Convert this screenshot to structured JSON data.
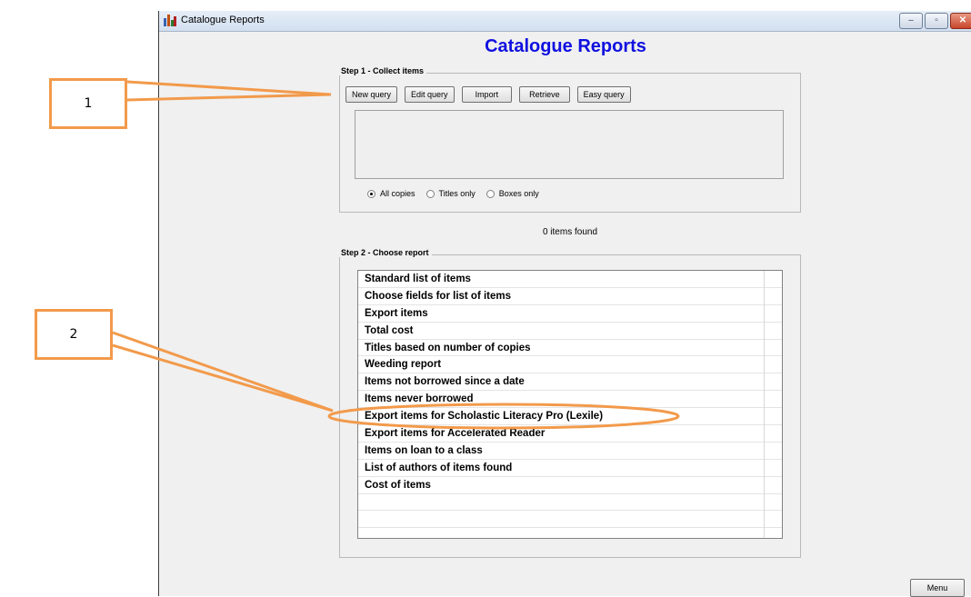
{
  "window": {
    "title": "Catalogue Reports",
    "icons": {
      "app": "bar-chart-icon",
      "minimize": "minimize-icon",
      "maximize": "maximize-icon",
      "close": "close-icon"
    },
    "minimize_glyph": "–",
    "maximize_glyph": "▫",
    "close_glyph": "✕"
  },
  "main_title": "Catalogue Reports",
  "step1": {
    "legend": "Step 1 - Collect items",
    "buttons": [
      "New query",
      "Edit query",
      "Import",
      "Retrieve",
      "Easy query"
    ],
    "radios": [
      {
        "label": "All copies",
        "selected": true
      },
      {
        "label": "Titles only",
        "selected": false
      },
      {
        "label": "Boxes only",
        "selected": false
      }
    ]
  },
  "items_found": "0 items found",
  "step2": {
    "legend": "Step 2 - Choose report",
    "reports": [
      "Standard list of items",
      "Choose fields for list of items",
      "Export items",
      "Total cost",
      "Titles based on number of copies",
      "Weeding report",
      "Items not borrowed since a date",
      "Items never borrowed",
      "Export items for Scholastic Literacy Pro (Lexile)",
      "Export items for Accelerated Reader",
      "Items on loan to a class",
      "List of authors of items found",
      "Cost of items",
      "",
      "",
      ""
    ]
  },
  "menu_button": "Menu",
  "annotations": {
    "callout1": "1",
    "callout2": "2",
    "color": "#f29a4b"
  }
}
